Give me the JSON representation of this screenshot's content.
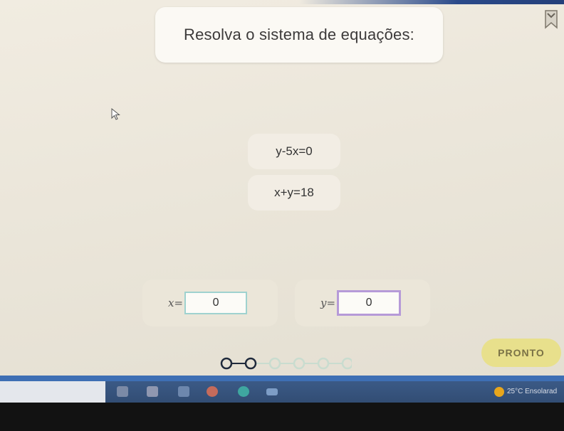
{
  "question": {
    "title": "Resolva o sistema de equações:"
  },
  "equations": [
    "y-5x=0",
    "x+y=18"
  ],
  "answers": {
    "x_label": "x=",
    "x_value": "0",
    "y_label": "y=",
    "y_value": "0"
  },
  "actions": {
    "submit_label": "PRONTO"
  },
  "progress": {
    "total_steps": 6,
    "current_step": 2
  },
  "taskbar": {
    "weather_text": "25°C Ensolarad",
    "icons": [
      "file-explorer-icon",
      "store-icon",
      "mail-icon",
      "chrome-icon",
      "edge-icon",
      "cloud-icon"
    ]
  },
  "colors": {
    "background": "#ede8dc",
    "card": "#fbf9f4",
    "answer_card": "#ebe6d9",
    "x_box_border": "#9fd2cf",
    "y_box_border": "#b69ad8",
    "submit_button": "#e8e08c",
    "progress_dot": "#1f2a3c",
    "progress_dot_future": "#c9dccf",
    "taskbar": "#35517a"
  }
}
